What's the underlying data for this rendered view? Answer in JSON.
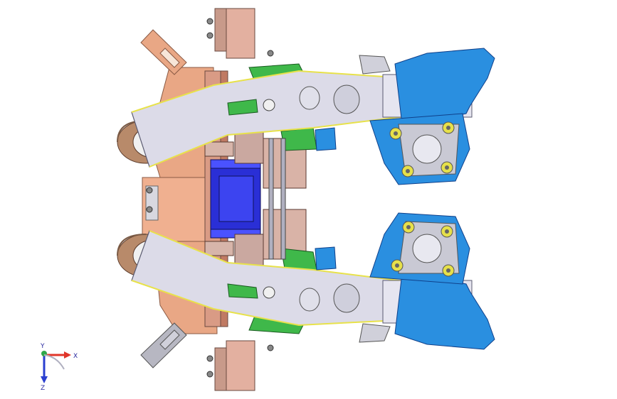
{
  "viewport": {
    "background": "#ffffff",
    "colors": {
      "copper": "#e9a785",
      "copper_dark": "#c9805f",
      "bracket_brown": "#c89a8a",
      "arm_grey": "#dcdbe8",
      "arm_outline": "#6b6b80",
      "weld_yellow": "#e8e24a",
      "blue_plate": "#2a8fe0",
      "blue_dark": "#1c5fb8",
      "cylinder_blue": "#2a2fd6",
      "green_plate": "#3fb84a",
      "bolt_ring": "#e6e04a",
      "tube_tan": "#b88a6a"
    }
  },
  "triad": {
    "x_label": "X",
    "y_label": "Y",
    "z_label": "Z",
    "x_color": "#e0352a",
    "y_color": "#2ea84a",
    "z_color": "#2a3fd0"
  }
}
